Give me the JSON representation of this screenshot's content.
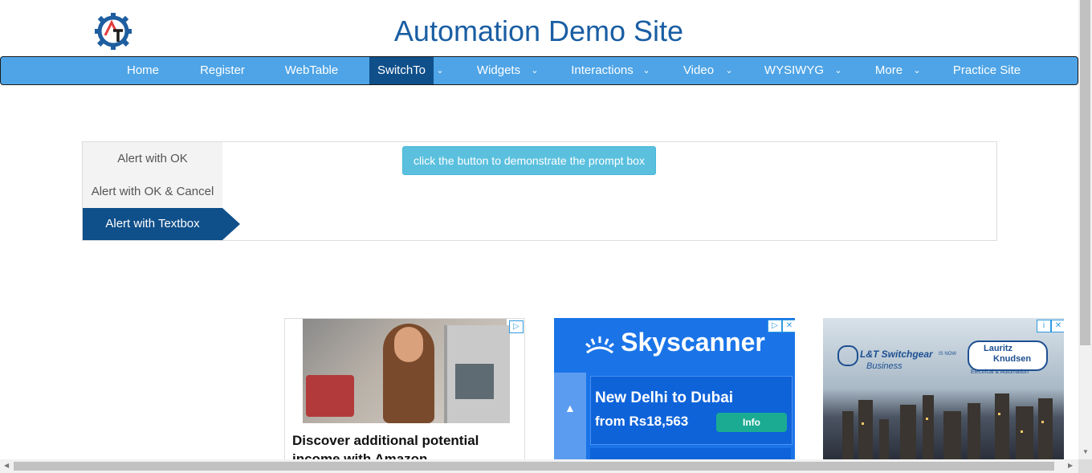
{
  "header": {
    "title": "Automation Demo Site",
    "logo_icon": "automation-testing-logo-gear"
  },
  "nav": {
    "items": [
      {
        "label": "Home",
        "dropdown": false,
        "active": false
      },
      {
        "label": "Register",
        "dropdown": false,
        "active": false
      },
      {
        "label": "WebTable",
        "dropdown": false,
        "active": false
      },
      {
        "label": "SwitchTo",
        "dropdown": true,
        "active": true
      },
      {
        "label": "Widgets",
        "dropdown": true,
        "active": false
      },
      {
        "label": "Interactions",
        "dropdown": true,
        "active": false
      },
      {
        "label": "Video",
        "dropdown": true,
        "active": false
      },
      {
        "label": "WYSIWYG",
        "dropdown": true,
        "active": false
      },
      {
        "label": "More",
        "dropdown": true,
        "active": false
      },
      {
        "label": "Practice Site",
        "dropdown": false,
        "active": false
      }
    ]
  },
  "alerts": {
    "tabs": [
      {
        "label": "Alert with OK",
        "active": false
      },
      {
        "label": "Alert with OK & Cancel",
        "active": false
      },
      {
        "label": "Alert with Textbox",
        "active": true
      }
    ],
    "prompt_button": "click the button to demonstrate the prompt box"
  },
  "ads": {
    "amazon": {
      "headline": "Discover additional potential income with Amazon"
    },
    "skyscanner": {
      "brand": "Skyscanner",
      "route": "New Delhi to Dubai",
      "price": "from Rs18,563",
      "cta": "Info"
    },
    "lnt": {
      "brand": "L&T Switchgear",
      "is_now": "IS NOW",
      "sub": "Business",
      "lk_line1": "Lauritz",
      "lk_line2": "Knudsen",
      "lk_sub": "Electrical & Automation"
    }
  },
  "colors": {
    "nav_bg": "#4ea4e6",
    "nav_active": "#0f4f8a",
    "title": "#1a5ea3",
    "prompt_btn": "#5bc0de"
  }
}
